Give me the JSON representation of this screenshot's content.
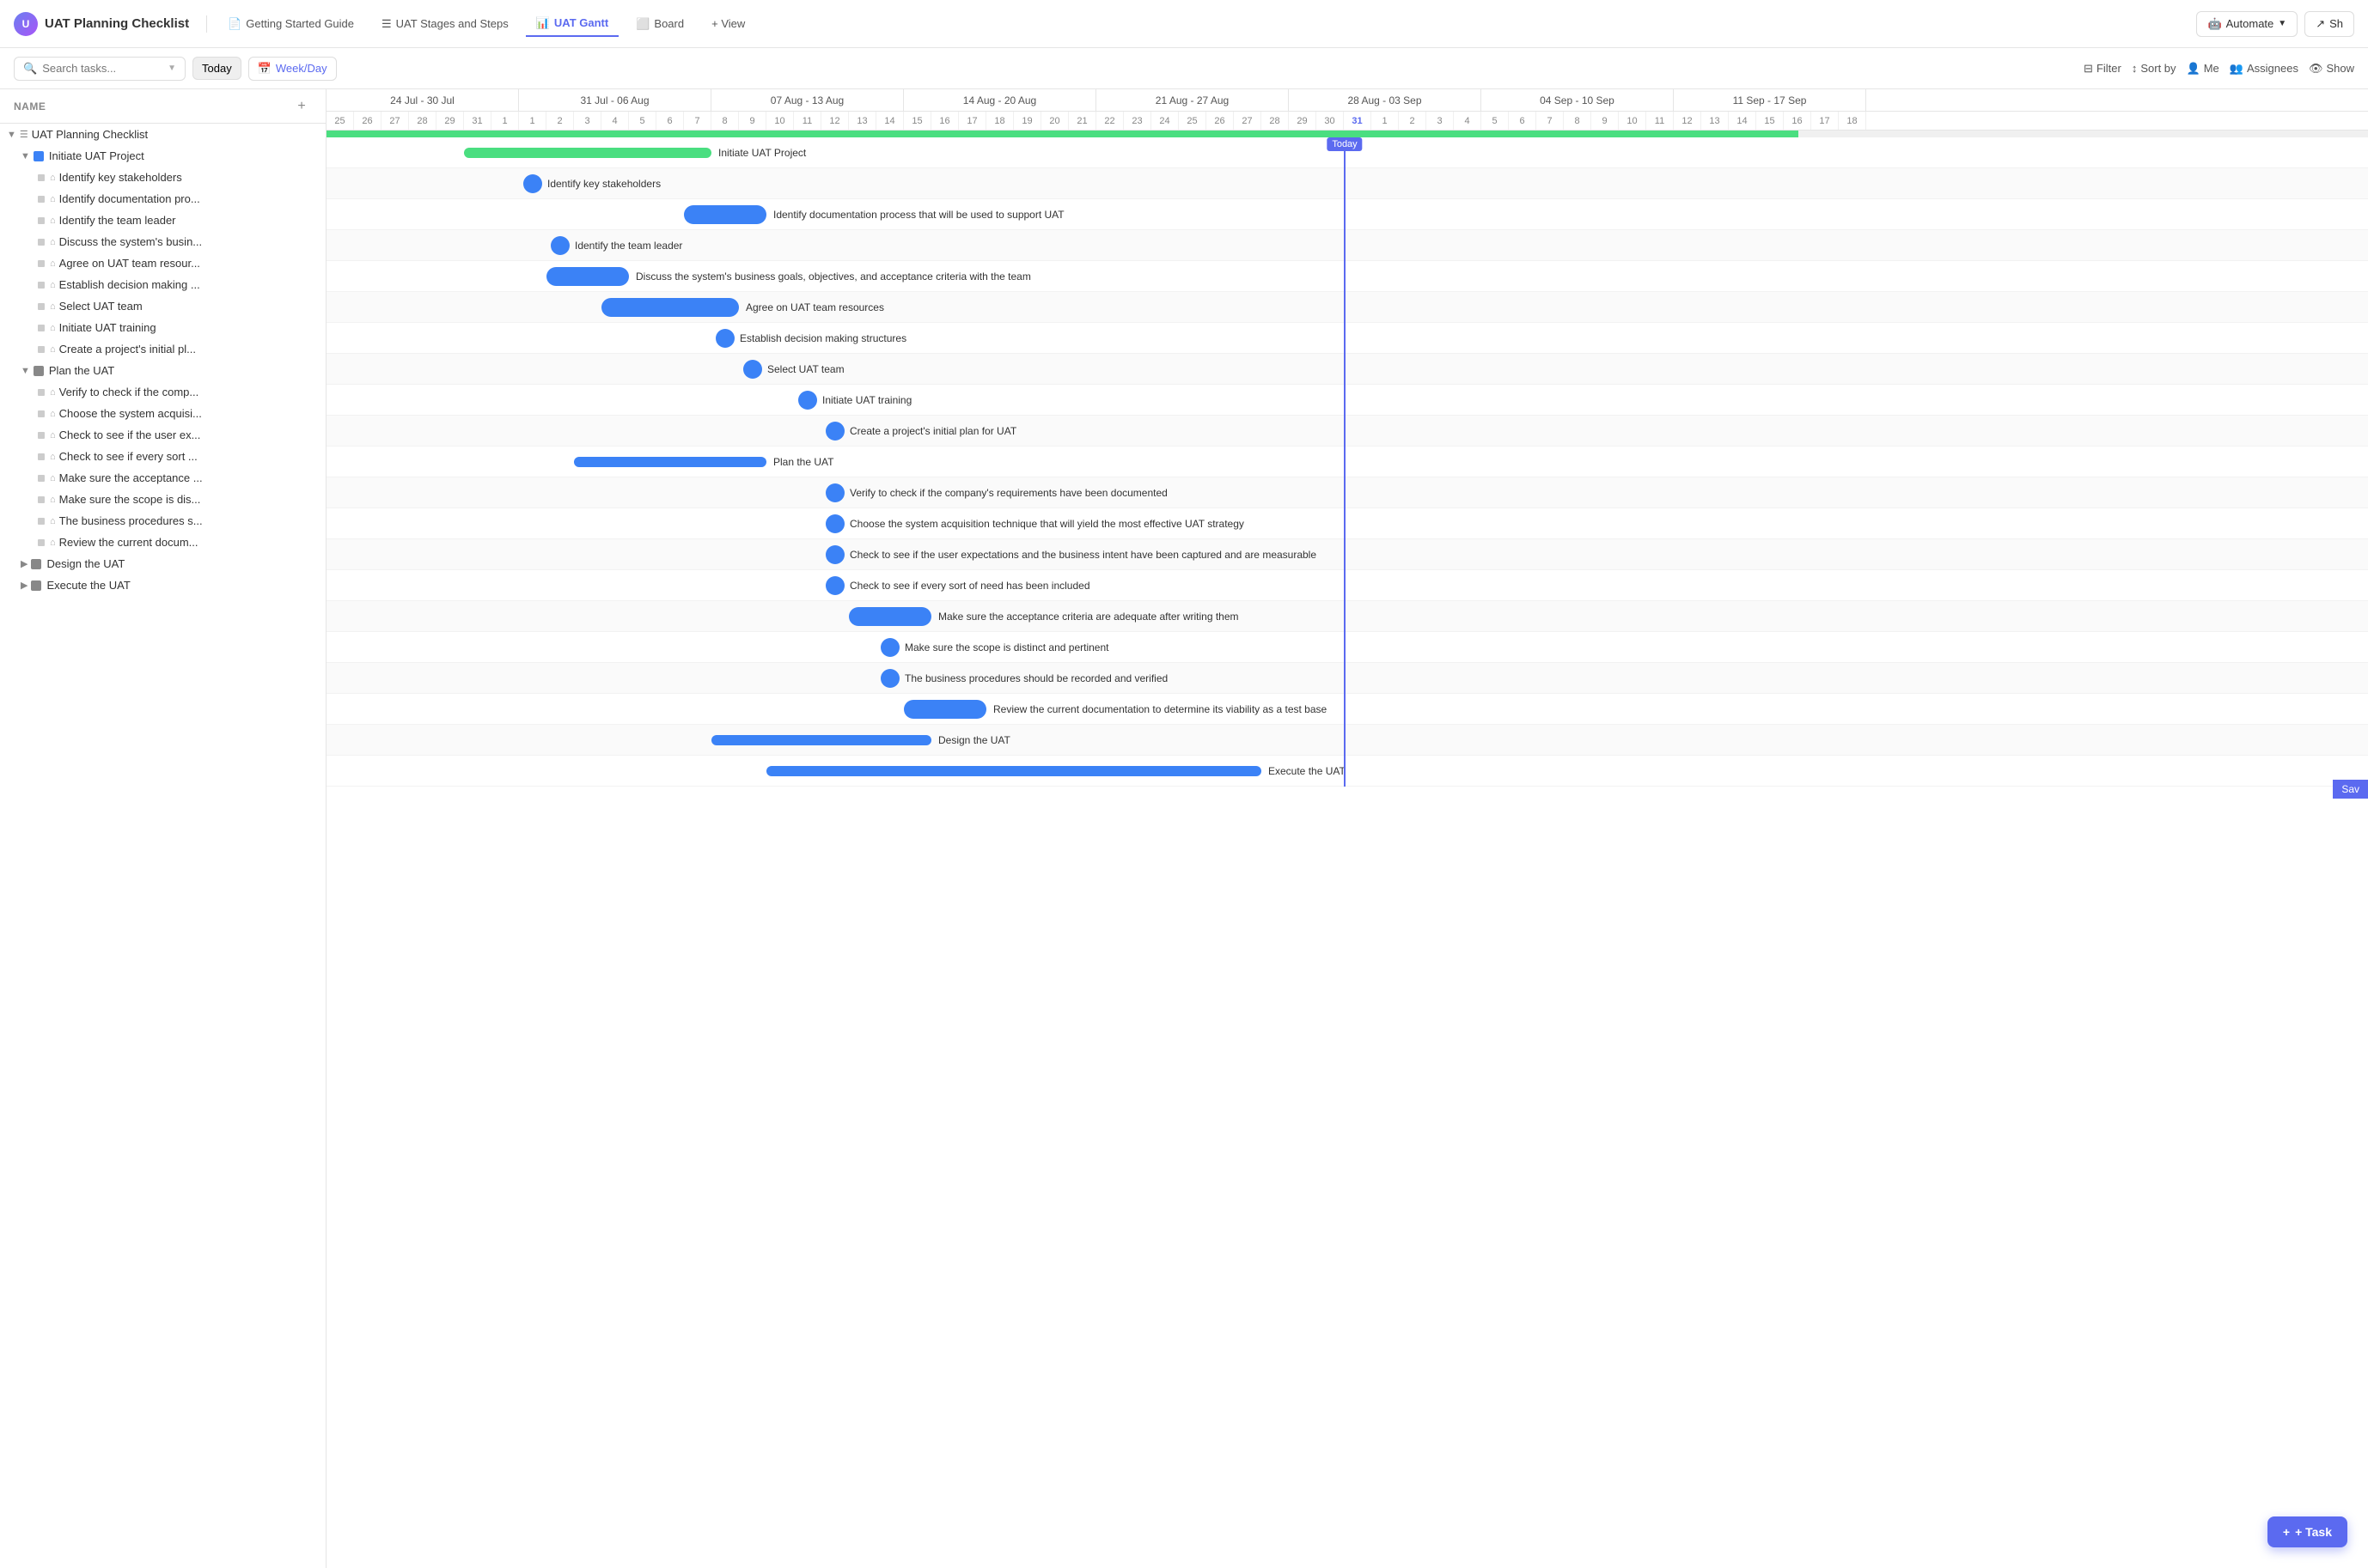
{
  "app": {
    "icon": "U",
    "title": "UAT Planning Checklist"
  },
  "nav": {
    "tabs": [
      {
        "id": "getting-started",
        "label": "Getting Started Guide",
        "icon": "📄",
        "active": false
      },
      {
        "id": "stages-steps",
        "label": "UAT Stages and Steps",
        "icon": "☰",
        "active": false
      },
      {
        "id": "gantt",
        "label": "UAT Gantt",
        "icon": "📊",
        "active": true
      },
      {
        "id": "board",
        "label": "Board",
        "icon": "⬜",
        "active": false
      },
      {
        "id": "view",
        "label": "+ View",
        "icon": "",
        "active": false
      }
    ],
    "automate_label": "Automate",
    "share_label": "Sh"
  },
  "toolbar": {
    "search_placeholder": "Search tasks...",
    "today_label": "Today",
    "week_day_label": "Week/Day",
    "filter_label": "Filter",
    "sort_by_label": "Sort by",
    "me_label": "Me",
    "assignees_label": "Assignees",
    "show_label": "Show"
  },
  "left_panel": {
    "header": "NAME",
    "tree": [
      {
        "id": "root",
        "level": 0,
        "type": "group",
        "label": "UAT Planning Checklist",
        "color": "#888",
        "expand": true
      },
      {
        "id": "initiate",
        "level": 1,
        "type": "milestone",
        "label": "Initiate UAT Project",
        "color": "#3b82f6",
        "expand": true
      },
      {
        "id": "t1",
        "level": 2,
        "type": "task",
        "label": "Identify key stakeholders"
      },
      {
        "id": "t2",
        "level": 2,
        "type": "task",
        "label": "Identify documentation pro..."
      },
      {
        "id": "t3",
        "level": 2,
        "type": "task",
        "label": "Identify the team leader"
      },
      {
        "id": "t4",
        "level": 2,
        "type": "task",
        "label": "Discuss the system's busin..."
      },
      {
        "id": "t5",
        "level": 2,
        "type": "task",
        "label": "Agree on UAT team resour..."
      },
      {
        "id": "t6",
        "level": 2,
        "type": "task",
        "label": "Establish decision making ..."
      },
      {
        "id": "t7",
        "level": 2,
        "type": "task",
        "label": "Select UAT team"
      },
      {
        "id": "t8",
        "level": 2,
        "type": "task",
        "label": "Initiate UAT training"
      },
      {
        "id": "t9",
        "level": 2,
        "type": "task",
        "label": "Create a project's initial pl..."
      },
      {
        "id": "plan",
        "level": 1,
        "type": "milestone",
        "label": "Plan the UAT",
        "color": "#888",
        "expand": true
      },
      {
        "id": "p1",
        "level": 2,
        "type": "task",
        "label": "Verify to check if the comp..."
      },
      {
        "id": "p2",
        "level": 2,
        "type": "task",
        "label": "Choose the system acquisi..."
      },
      {
        "id": "p3",
        "level": 2,
        "type": "task",
        "label": "Check to see if the user ex..."
      },
      {
        "id": "p4",
        "level": 2,
        "type": "task",
        "label": "Check to see if every sort ..."
      },
      {
        "id": "p5",
        "level": 2,
        "type": "task",
        "label": "Make sure the acceptance ..."
      },
      {
        "id": "p6",
        "level": 2,
        "type": "task",
        "label": "Make sure the scope is dis..."
      },
      {
        "id": "p7",
        "level": 2,
        "type": "task",
        "label": "The business procedures s..."
      },
      {
        "id": "p8",
        "level": 2,
        "type": "task",
        "label": "Review the current docum..."
      },
      {
        "id": "design",
        "level": 1,
        "type": "milestone",
        "label": "Design the UAT",
        "color": "#888",
        "expand": false
      },
      {
        "id": "execute",
        "level": 1,
        "type": "milestone",
        "label": "Execute the UAT",
        "color": "#888",
        "expand": false
      }
    ]
  },
  "gantt": {
    "weeks": [
      {
        "label": "24 Jul - 30 Jul",
        "days": 7
      },
      {
        "label": "31 Jul - 06 Aug",
        "days": 7
      },
      {
        "label": "07 Aug - 13 Aug",
        "days": 7
      },
      {
        "label": "14 Aug - 20 Aug",
        "days": 7
      },
      {
        "label": "21 Aug - 27 Aug",
        "days": 7
      },
      {
        "label": "28 Aug - 03 Sep",
        "days": 7
      },
      {
        "label": "04 Sep - 10 Sep",
        "days": 7
      },
      {
        "label": "11 Sep - 17 Sep",
        "days": 7
      }
    ],
    "today_col": 37,
    "today_label": "Today",
    "day_width": 32
  },
  "bars": [
    {
      "id": "bar-initiate",
      "label": "Initiate UAT Project",
      "start": 7,
      "width": 8,
      "type": "group-bar",
      "color": "#4ade80"
    },
    {
      "id": "bar-t1",
      "label": "Identify key stakeholders",
      "start": 7,
      "width": 1,
      "type": "dot",
      "color": "#3b82f6"
    },
    {
      "id": "bar-t2",
      "label": "Identify documentation process that will be used to support UAT",
      "start": 13,
      "width": 3,
      "type": "bar",
      "color": "#3b82f6"
    },
    {
      "id": "bar-t3",
      "label": "Identify the team leader",
      "start": 8,
      "width": 1,
      "type": "dot",
      "color": "#3b82f6"
    },
    {
      "id": "bar-t4",
      "label": "Discuss the system's business goals, objectives, and acceptance criteria with the team",
      "start": 8,
      "width": 3,
      "type": "bar",
      "color": "#3b82f6"
    },
    {
      "id": "bar-t5",
      "label": "Agree on UAT team resources",
      "start": 10,
      "width": 5,
      "type": "bar-wide",
      "color": "#3b82f6"
    },
    {
      "id": "bar-t6",
      "label": "Establish decision making structures",
      "start": 14,
      "width": 1,
      "type": "dot",
      "color": "#3b82f6"
    },
    {
      "id": "bar-t7",
      "label": "Select UAT team",
      "start": 15,
      "width": 1,
      "type": "dot",
      "color": "#3b82f6"
    },
    {
      "id": "bar-t8",
      "label": "Initiate UAT training",
      "start": 17,
      "width": 1,
      "type": "dot",
      "color": "#3b82f6"
    },
    {
      "id": "bar-t9",
      "label": "Create a project's initial plan for UAT",
      "start": 18,
      "width": 1,
      "type": "dot",
      "color": "#3b82f6"
    },
    {
      "id": "bar-plan",
      "label": "Plan the UAT",
      "start": 10,
      "width": 6,
      "type": "group-bar",
      "color": "#3b82f6"
    },
    {
      "id": "bar-p1",
      "label": "Verify to check if the company's requirements have been documented",
      "start": 18,
      "width": 1,
      "type": "dot",
      "color": "#3b82f6"
    },
    {
      "id": "bar-p2",
      "label": "Choose the system acquisition technique that will yield the most effective UAT strategy",
      "start": 18,
      "width": 1,
      "type": "dot",
      "color": "#3b82f6"
    },
    {
      "id": "bar-p3",
      "label": "Check to see if the user expectations and the business intent have been captured and are measurable",
      "start": 18,
      "width": 1,
      "type": "dot",
      "color": "#3b82f6"
    },
    {
      "id": "bar-p4",
      "label": "Check to see if every sort of need has been included",
      "start": 18,
      "width": 1,
      "type": "dot",
      "color": "#3b82f6"
    },
    {
      "id": "bar-p5",
      "label": "Make sure the acceptance criteria are adequate after writing them",
      "start": 19,
      "width": 3,
      "type": "bar",
      "color": "#3b82f6"
    },
    {
      "id": "bar-p6",
      "label": "Make sure the scope is distinct and pertinent",
      "start": 20,
      "width": 1,
      "type": "dot",
      "color": "#3b82f6"
    },
    {
      "id": "bar-p7",
      "label": "The business procedures should be recorded and verified",
      "start": 20,
      "width": 1,
      "type": "dot",
      "color": "#3b82f6"
    },
    {
      "id": "bar-p8",
      "label": "Review the current documentation to determine its viability as a test base",
      "start": 21,
      "width": 3,
      "type": "bar",
      "color": "#3b82f6"
    },
    {
      "id": "bar-design",
      "label": "Design the UAT",
      "start": 14,
      "width": 8,
      "type": "group-bar-blue",
      "color": "#3b82f6"
    },
    {
      "id": "bar-execute",
      "label": "Execute the UAT",
      "start": 16,
      "width": 18,
      "type": "group-bar-blue-wide",
      "color": "#3b82f6"
    }
  ],
  "fab": {
    "label": "+ Task"
  },
  "save_label": "Sav"
}
